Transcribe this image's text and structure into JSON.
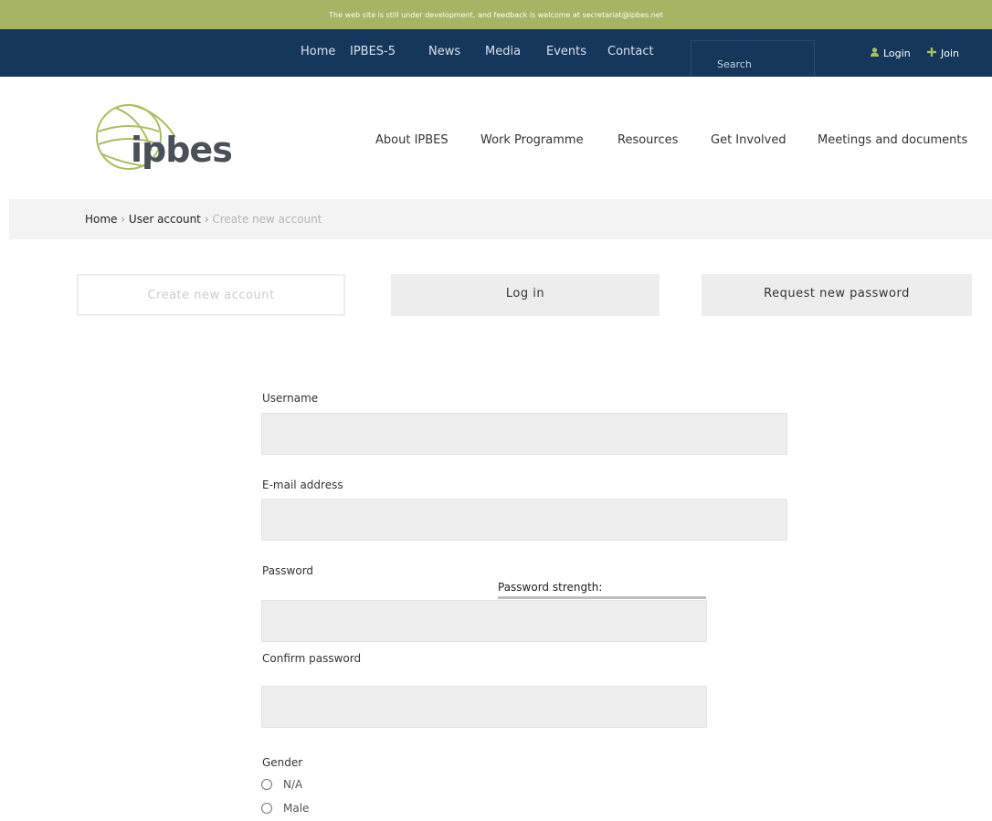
{
  "notice": {
    "text": "The web site is still under development, and feedback is welcome at secretariat@ipbes.net"
  },
  "topnav": {
    "links": [
      "Home",
      "IPBES-5",
      "News",
      "Media",
      "Events",
      "Contact"
    ],
    "search_placeholder": "Search",
    "login_label": "Login",
    "join_label": "Join"
  },
  "logo": {
    "text": "ipbes"
  },
  "mainnav": {
    "links": [
      "About IPBES",
      "Work Programme",
      "Resources",
      "Get Involved",
      "Meetings and documents"
    ]
  },
  "breadcrumb": {
    "home": "Home",
    "user_account": "User account",
    "current": "Create new account",
    "separator": "›"
  },
  "tabs": [
    "Create new account",
    "Log in",
    "Request new password"
  ],
  "form": {
    "username_label": "Username",
    "email_label": "E-mail address",
    "password_label": "Password",
    "password_strength_label": "Password strength:",
    "confirm_password_label": "Confirm password",
    "gender_label": "Gender",
    "gender_options": [
      "N/A",
      "Male"
    ]
  },
  "colors": {
    "notice_bg": "#a7b463",
    "topnav_bg": "#16375c",
    "accent_green": "#a7c05b"
  }
}
